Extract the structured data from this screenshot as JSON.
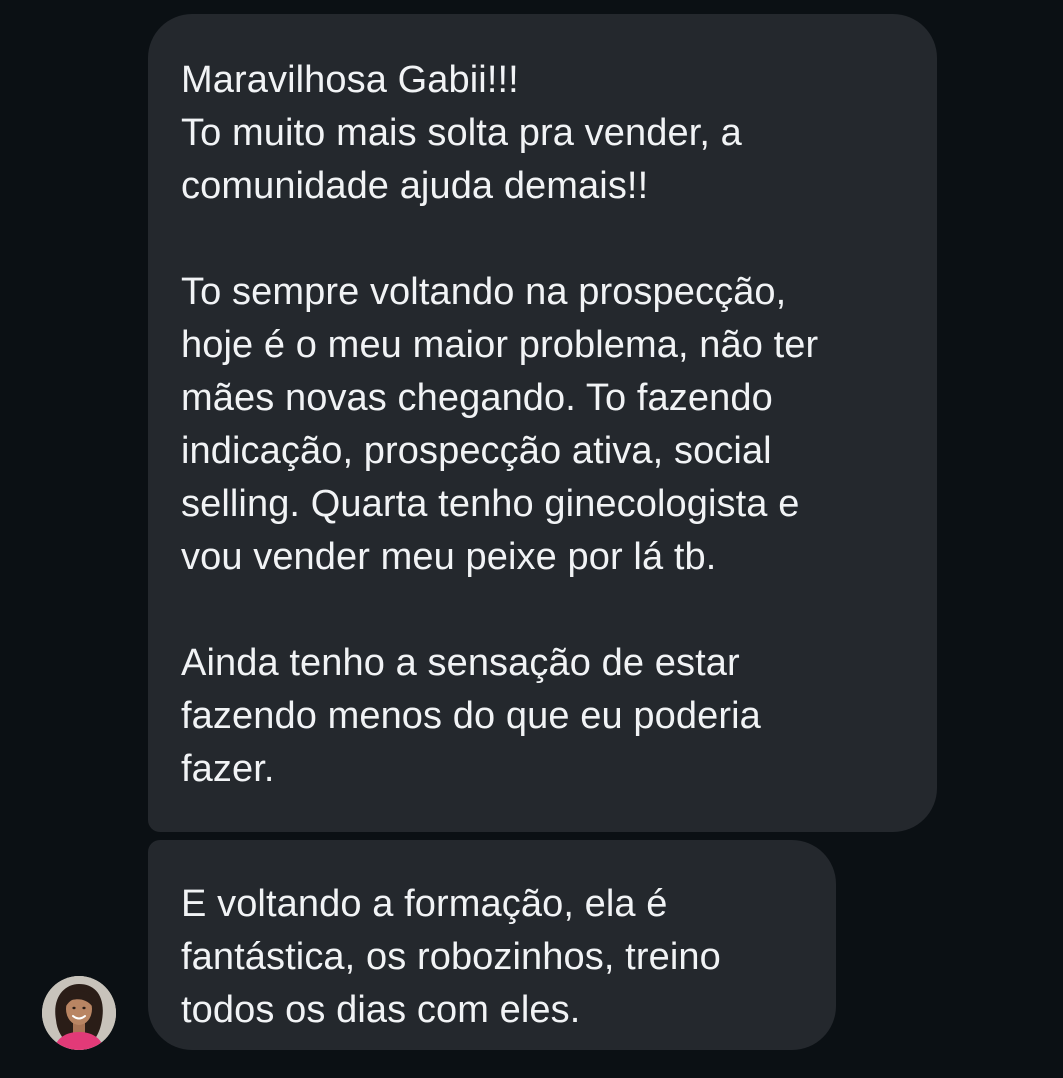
{
  "conversation": {
    "messages": [
      {
        "paragraphs": [
          [
            "Maravilhosa Gabii!!!",
            "To muito mais solta pra vender, a",
            "comunidade ajuda demais!!"
          ],
          [
            "To sempre voltando na prospecção,",
            "hoje é o meu maior problema, não ter",
            "mães novas chegando. To fazendo",
            "indicação, prospecção ativa, social",
            "selling. Quarta tenho ginecologista e",
            "vou vender meu peixe por lá tb."
          ],
          [
            "Ainda tenho a sensação de estar",
            "fazendo menos do que eu poderia",
            "fazer."
          ]
        ]
      },
      {
        "paragraphs": [
          [
            "E voltando a formação, ela é",
            "fantástica, os robozinhos, treino",
            "todos os dias com eles."
          ]
        ]
      }
    ],
    "sender_avatar": {
      "icon": "profile-photo",
      "colors": {
        "background": "#c8c3bb",
        "hair": "#2a1d17",
        "skin": "#b98563",
        "top": "#e23a78"
      }
    }
  },
  "theme": {
    "background": "#0b1014",
    "bubble": "#24282d",
    "text": "#f1f3f5"
  }
}
